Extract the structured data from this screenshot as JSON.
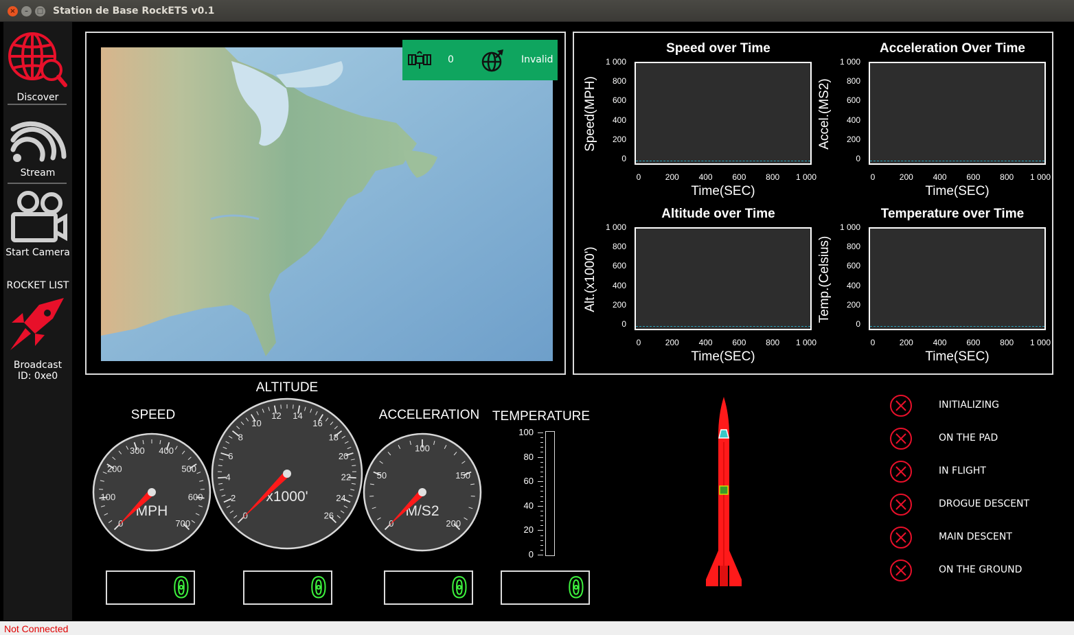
{
  "window": {
    "title": "Station de Base RockETS v0.1"
  },
  "sidebar": {
    "discover_label": "Discover",
    "stream_label": "Stream",
    "camera_label": "Start Camera",
    "rocket_list_title": "ROCKET LIST",
    "rocket_name": "Broadcast",
    "rocket_id": "ID: 0xe0"
  },
  "gps": {
    "satellites": "0",
    "fix_status": "Invalid"
  },
  "charts": [
    {
      "title": "Speed over Time",
      "ylabel": "Speed(MPH)",
      "xlabel": "Time(SEC)"
    },
    {
      "title": "Acceleration Over Time",
      "ylabel": "Accel.(MS2)",
      "xlabel": "Time(SEC)"
    },
    {
      "title": "Altitude over Time",
      "ylabel": "Alt.(x1000')",
      "xlabel": "Time(SEC)"
    },
    {
      "title": "Temperature over Time",
      "ylabel": "Temp.(Celsius)",
      "xlabel": "Time(SEC)"
    }
  ],
  "chart_data": [
    {
      "type": "line",
      "title": "Speed over Time",
      "xlabel": "Time(SEC)",
      "ylabel": "Speed(MPH)",
      "xlim": [
        0,
        1000
      ],
      "ylim": [
        0,
        1000
      ],
      "x_ticks": [
        "0",
        "200",
        "400",
        "600",
        "800",
        "1 000"
      ],
      "y_ticks": [
        "0",
        "200",
        "400",
        "600",
        "800",
        "1 000"
      ],
      "series": []
    },
    {
      "type": "line",
      "title": "Acceleration Over Time",
      "xlabel": "Time(SEC)",
      "ylabel": "Accel.(MS2)",
      "xlim": [
        0,
        1000
      ],
      "ylim": [
        0,
        1000
      ],
      "x_ticks": [
        "0",
        "200",
        "400",
        "600",
        "800",
        "1 000"
      ],
      "y_ticks": [
        "0",
        "200",
        "400",
        "600",
        "800",
        "1 000"
      ],
      "series": []
    },
    {
      "type": "line",
      "title": "Altitude over Time",
      "xlabel": "Time(SEC)",
      "ylabel": "Alt.(x1000')",
      "xlim": [
        0,
        1000
      ],
      "ylim": [
        0,
        1000
      ],
      "x_ticks": [
        "0",
        "200",
        "400",
        "600",
        "800",
        "1 000"
      ],
      "y_ticks": [
        "0",
        "200",
        "400",
        "600",
        "800",
        "1 000"
      ],
      "series": []
    },
    {
      "type": "line",
      "title": "Temperature over Time",
      "xlabel": "Time(SEC)",
      "ylabel": "Temp.(Celsius)",
      "xlim": [
        0,
        1000
      ],
      "ylim": [
        0,
        1000
      ],
      "x_ticks": [
        "0",
        "200",
        "400",
        "600",
        "800",
        "1 000"
      ],
      "y_ticks": [
        "0",
        "200",
        "400",
        "600",
        "800",
        "1 000"
      ],
      "series": []
    }
  ],
  "gauges": {
    "speed": {
      "title": "SPEED",
      "unit": "MPH",
      "labels": [
        "0",
        "100",
        "200",
        "300",
        "400",
        "500",
        "600",
        "700"
      ],
      "value": 0,
      "lcd": "0"
    },
    "altitude": {
      "title": "ALTITUDE",
      "unit": "x1000'",
      "labels": [
        "0",
        "2",
        "4",
        "6",
        "8",
        "10",
        "12",
        "14",
        "16",
        "18",
        "20",
        "22",
        "24",
        "26"
      ],
      "value": 0,
      "lcd": "0"
    },
    "acceleration": {
      "title": "ACCELERATION",
      "unit": "M/S2",
      "labels": [
        "0",
        "50",
        "100",
        "150",
        "200"
      ],
      "value": 0,
      "lcd": "0"
    },
    "temperature": {
      "title": "TEMPERATURE",
      "labels": [
        "100",
        "80",
        "60",
        "40",
        "20",
        "0"
      ],
      "value": 0,
      "lcd": "0"
    }
  },
  "flight_states": [
    {
      "label": "INITIALIZING",
      "active": false
    },
    {
      "label": "ON THE PAD",
      "active": false
    },
    {
      "label": "IN FLIGHT",
      "active": false
    },
    {
      "label": "DROGUE DESCENT",
      "active": false
    },
    {
      "label": "MAIN DESCENT",
      "active": false
    },
    {
      "label": "ON THE GROUND",
      "active": false
    }
  ],
  "colors": {
    "accent_red": "#e8102a",
    "gps_green": "#0fa55f",
    "lcd_green": "#3ef33e",
    "status_red": "#e00000"
  },
  "statusbar": {
    "connection": "Not Connected"
  }
}
